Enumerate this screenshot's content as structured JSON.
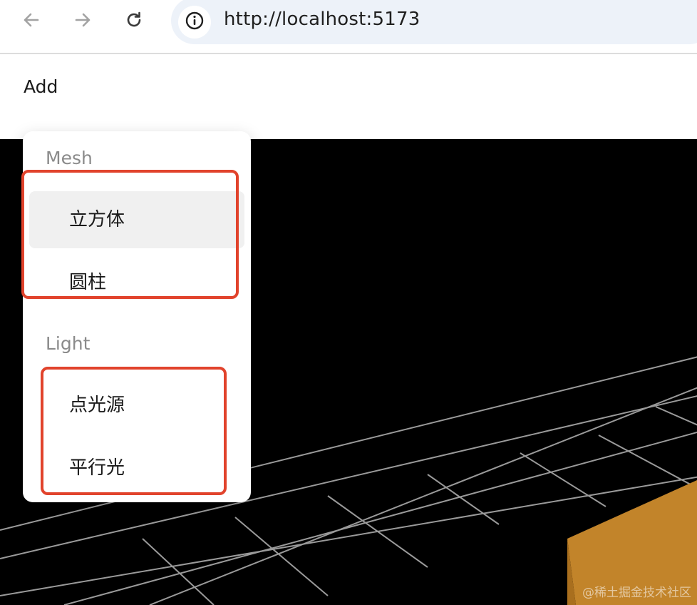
{
  "browser": {
    "back_icon": "arrow-left-icon",
    "forward_icon": "arrow-right-icon",
    "reload_icon": "reload-icon",
    "site_info_icon": "info-icon",
    "url": "http://localhost:5173"
  },
  "menubar": {
    "trigger_label": "Add"
  },
  "dropdown": {
    "groups": [
      {
        "title": "Mesh",
        "items": [
          {
            "label": "立方体",
            "active": true
          },
          {
            "label": "圆柱",
            "active": false
          }
        ]
      },
      {
        "title": "Light",
        "items": [
          {
            "label": "点光源",
            "active": false
          },
          {
            "label": "平行光",
            "active": false
          }
        ]
      }
    ]
  },
  "annotations": {
    "highlight_color": "#e1432c"
  },
  "scene": {
    "background": "#000000",
    "grid_color": "#9a9a9a",
    "cube_color": "#c2842a"
  },
  "watermark": "@稀土掘金技术社区"
}
